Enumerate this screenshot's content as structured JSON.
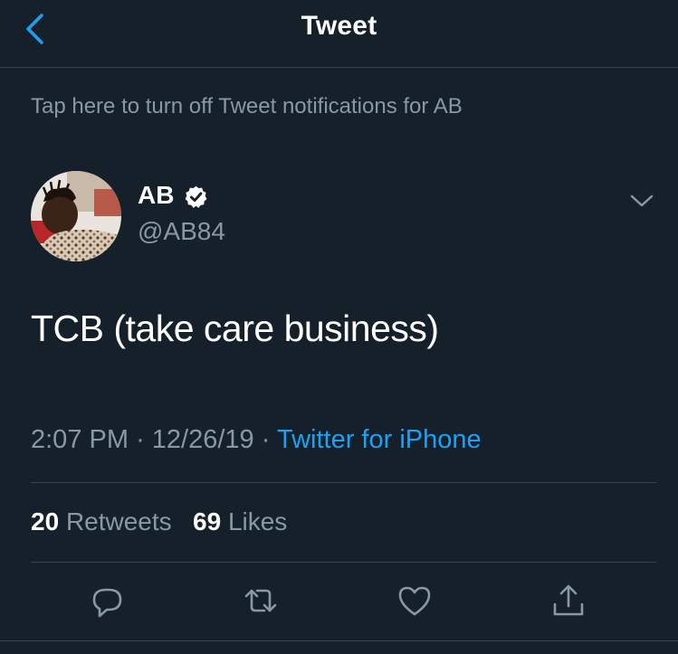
{
  "header": {
    "title": "Tweet",
    "back_icon": "chevron-left-icon"
  },
  "notification_banner": {
    "text": "Tap here to turn off Tweet notifications for AB"
  },
  "tweet": {
    "author": {
      "name": "AB",
      "handle": "@AB84",
      "verified": true
    },
    "text": "TCB (take care business)",
    "time": "2:07 PM",
    "date": "12/26/19",
    "separator": "·",
    "source": "Twitter for iPhone"
  },
  "stats": {
    "retweets_count": "20",
    "retweets_label": "Retweets",
    "likes_count": "69",
    "likes_label": "Likes"
  },
  "actions": [
    {
      "name": "reply",
      "icon": "reply-icon"
    },
    {
      "name": "retweet",
      "icon": "retweet-icon"
    },
    {
      "name": "like",
      "icon": "heart-icon"
    },
    {
      "name": "share",
      "icon": "share-icon"
    }
  ],
  "colors": {
    "background": "#15202b",
    "divider": "#38444d",
    "secondary_text": "#8899a6",
    "accent": "#1da1f2",
    "primary_text": "#ffffff"
  }
}
